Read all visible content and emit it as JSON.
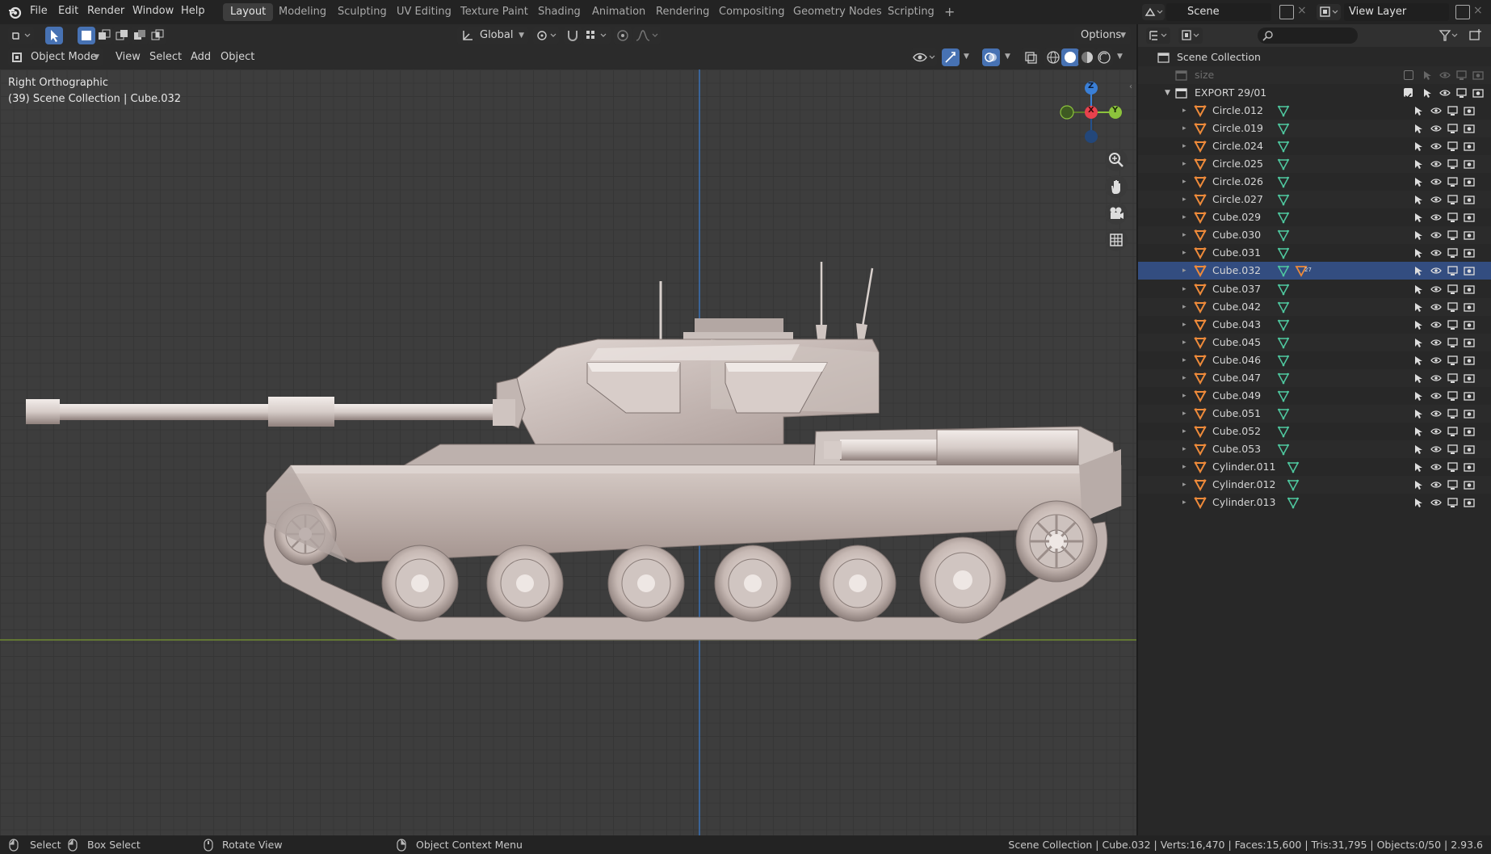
{
  "topbar": {
    "menus": [
      "File",
      "Edit",
      "Render",
      "Window",
      "Help"
    ],
    "workspaces": [
      "Layout",
      "Modeling",
      "Sculpting",
      "UV Editing",
      "Texture Paint",
      "Shading",
      "Animation",
      "Rendering",
      "Compositing",
      "Geometry Nodes",
      "Scripting"
    ],
    "active_workspace": "Layout",
    "add_workspace": "+",
    "scene_label": "Scene",
    "view_layer_label": "View Layer"
  },
  "viewport_header": {
    "transform_orientation": "Global",
    "options_label": "Options",
    "mode": "Object Mode",
    "menus": [
      "View",
      "Select",
      "Add",
      "Object"
    ]
  },
  "viewport": {
    "view_name": "Right Orthographic",
    "context": "(39) Scene Collection | Cube.032",
    "axes": {
      "x": "X",
      "y": "Y",
      "z": "Z"
    },
    "colors": {
      "x_axis": "#e8424d",
      "y_axis": "#8cc33c",
      "z_axis": "#3a7fd6"
    }
  },
  "outliner": {
    "root": "Scene Collection",
    "hidden_collection": "size",
    "collection": "EXPORT 29/01",
    "selected_object": "Cube.032",
    "objects": [
      "Circle.012",
      "Circle.019",
      "Circle.024",
      "Circle.025",
      "Circle.026",
      "Circle.027",
      "Cube.029",
      "Cube.030",
      "Cube.031",
      "Cube.032",
      "Cube.037",
      "Cube.042",
      "Cube.043",
      "Cube.045",
      "Cube.046",
      "Cube.047",
      "Cube.049",
      "Cube.051",
      "Cube.052",
      "Cube.053",
      "Cylinder.011",
      "Cylinder.012",
      "Cylinder.013"
    ],
    "selected_modifier_badge": "27"
  },
  "statusbar": {
    "select": "Select",
    "box_select": "Box Select",
    "rotate_view": "Rotate View",
    "context_menu": "Object Context Menu",
    "stats": "Scene Collection | Cube.032 | Verts:16,470 | Faces:15,600 | Tris:31,795 | Objects:0/50 | 2.93.6"
  }
}
